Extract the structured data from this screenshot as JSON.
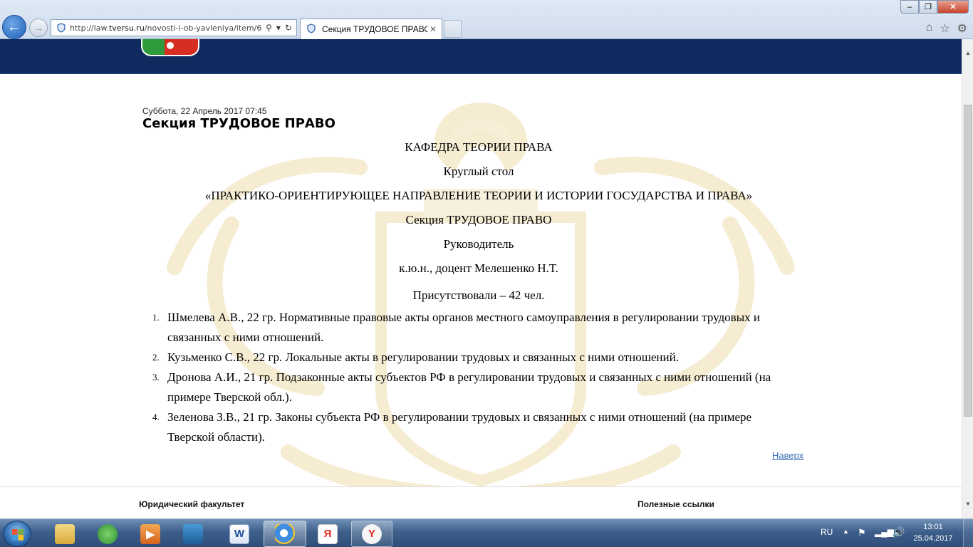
{
  "browser": {
    "url_prefix": "http://law.",
    "url_domain": "tversu.ru",
    "url_path": "/novosti-i-ob-yavleniya/item/6",
    "tab_title": "Секция ТРУДОВОЕ ПРАВО",
    "back_icon": "←",
    "forward_icon": "→",
    "search_icon": "⚲",
    "dropdown_icon": "▾",
    "refresh_icon": "↻",
    "close_tab_icon": "✕",
    "home_icon": "⌂",
    "favorites_icon": "☆",
    "settings_icon": "⚙",
    "window_min": "–",
    "window_max": "❐",
    "window_close": "✕"
  },
  "article": {
    "date": "Суббота, 22 Апрель 2017 07:45",
    "title": "Секция ТРУДОВОЕ ПРАВО",
    "lines": [
      "КАФЕДРА ТЕОРИИ ПРАВА",
      "Круглый стол",
      "«ПРАКТИКО-ОРИЕНТИРУЮЩЕЕ НАПРАВЛЕНИЕ ТЕОРИИ И ИСТОРИИ ГОСУДАРСТВА И ПРАВА»",
      "Секция ТРУДОВОЕ ПРАВО",
      "Руководитель",
      "к.ю.н., доцент Мелешенко Н.Т.",
      "Присутствовали – 42 чел."
    ],
    "participants": [
      {
        "num": "1.",
        "text": "Шмелева А.В., 22 гр. Нормативные правовые акты органов местного самоуправления в регулировании трудовых и связанных с ними отношений."
      },
      {
        "num": "2.",
        "text": "Кузьменко С.В., 22 гр. Локальные акты в регулировании трудовых и связанных с ними отношений."
      },
      {
        "num": "3.",
        "text": "Дронова А.И., 21 гр. Подзаконные акты субъектов РФ в регулировании трудовых и связанных с ними отношений (на примере Тверской обл.)."
      },
      {
        "num": "4.",
        "text": "Зеленова З.В., 21 гр. Законы субъекта РФ в регулировании трудовых и связанных с ними отношений (на примере Тверской области)."
      }
    ],
    "top_link": "Наверх"
  },
  "footer": {
    "left_heading": "Юридический факультет",
    "right_heading": "Полезные ссылки"
  },
  "scrollbar": {
    "up_icon": "▲",
    "down_icon": "▼"
  },
  "taskbar": {
    "word_icon_text": "W",
    "ie_icon_text": "e",
    "yabrowser_icon_text": "Я",
    "yandex_icon_text": "Y",
    "media_icon_text": "▶",
    "tray_lang": "RU",
    "tray_up_icon": "▲",
    "tray_flag_icon": "⚑",
    "tray_net_icon": "▂▄▆",
    "tray_vol_icon": "🔊",
    "time": "13:01",
    "date": "25.04.2017"
  },
  "colors": {
    "site_header": "#0e2a5e",
    "link": "#3b6fb6",
    "watermark": "#f5ecd2"
  }
}
